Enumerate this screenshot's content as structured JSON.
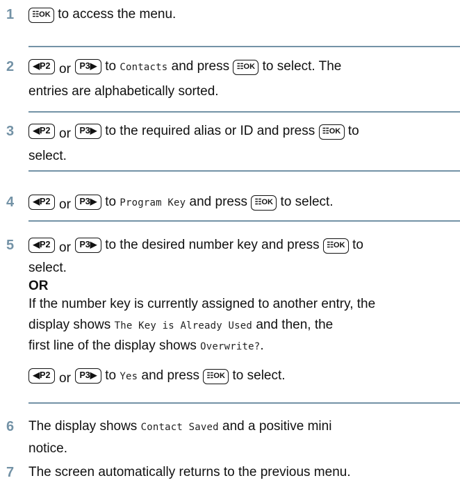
{
  "keys": {
    "ok": "☷OK",
    "p2": "◀P2",
    "p3": "P3▶"
  },
  "steps": [
    {
      "num": "1",
      "text": "to access the menu."
    },
    {
      "num": "2",
      "t1": "or",
      "t2": "to",
      "mono": "Contacts",
      "t3": "and press",
      "t4": "to select. The",
      "line2": "entries are alphabetically sorted."
    },
    {
      "num": "3",
      "t1": "or",
      "t2": "to the required alias or ID and press",
      "t3": "to",
      "line2": "select."
    },
    {
      "num": "4",
      "t1": "or",
      "t2": "to",
      "mono": "Program Key",
      "t3": "and press",
      "t4": "to select."
    },
    {
      "num": "5",
      "t1": "or",
      "t2": "to the desired number key and press",
      "t3": "to",
      "line2": "select.",
      "or_label": "OR",
      "p1": "If the number key is currently assigned to another entry, the",
      "p2a": "display shows",
      "p2mono": "The Key is Already Used",
      "p2b": "and then, the",
      "p3a": "first line of the display shows",
      "p3mono": "Overwrite?",
      "p3b": ".",
      "s1": "or",
      "s2": "to",
      "smono": "Yes",
      "s3": "and press",
      "s4": "to select."
    },
    {
      "num": "6",
      "t1": "The display shows",
      "mono": "Contact Saved",
      "t2": "and a positive mini",
      "line2": "notice."
    },
    {
      "num": "7",
      "text": "The screen automatically returns to the previous menu."
    }
  ]
}
